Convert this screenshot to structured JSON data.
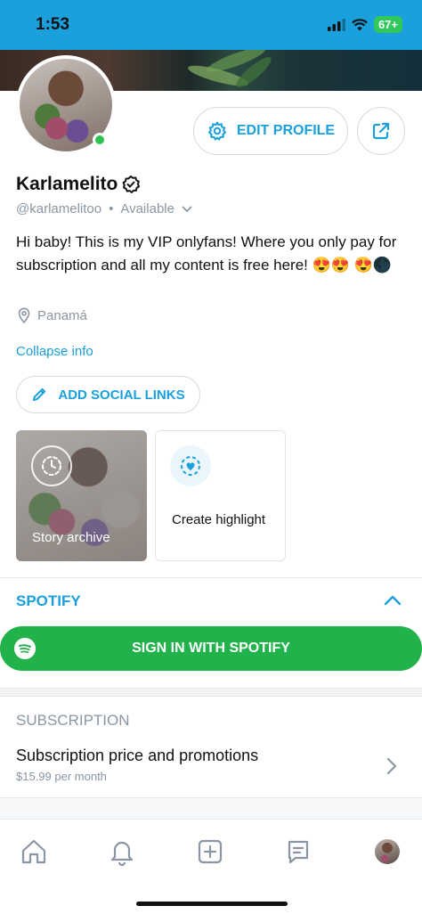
{
  "status_bar": {
    "time": "1:53",
    "battery": "67+"
  },
  "profile": {
    "name": "Karlamelito",
    "handle": "@karlamelitoo",
    "separator": "•",
    "status": "Available",
    "bio": "Hi baby! This is my VIP onlyfans! Where you only pay for subscription and all my content is free here! 😍😍 😍🌑",
    "location": "Panamá",
    "collapse_label": "Collapse info",
    "online": true
  },
  "actions": {
    "edit_profile_label": "EDIT PROFILE",
    "add_social_links_label": "ADD SOCIAL LINKS"
  },
  "highlights": {
    "story_archive_label": "Story archive",
    "create_highlight_label": "Create highlight"
  },
  "spotify": {
    "title": "SPOTIFY",
    "sign_in_label": "SIGN IN WITH SPOTIFY"
  },
  "subscription": {
    "title": "SUBSCRIPTION",
    "row_label": "Subscription price and promotions",
    "price": "$15.99 per month"
  },
  "tabbar": {
    "items": [
      "home-icon",
      "bell-icon",
      "plus-square-icon",
      "message-icon",
      "profile-avatar"
    ]
  },
  "colors": {
    "accent": "#1aa0dc",
    "spotify_green": "#22b24c",
    "online_green": "#2ec24f",
    "muted": "#8a96a3"
  }
}
